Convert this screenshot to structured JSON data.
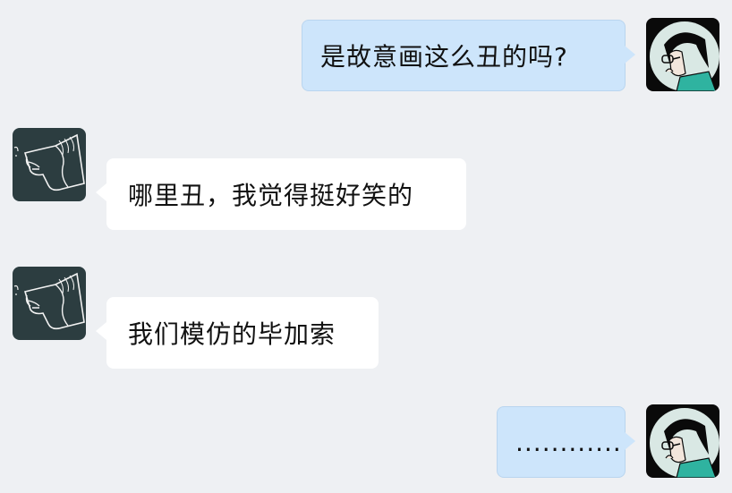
{
  "messages": [
    {
      "sender": "me",
      "text": "是故意画这么丑的吗?",
      "avatar": "woman-with-glasses-avatar"
    },
    {
      "sender": "other",
      "text": "哪里丑，我觉得挺好笑的",
      "avatar": "sketch-face-avatar"
    },
    {
      "sender": "other",
      "text": "我们模仿的毕加索",
      "avatar": "sketch-face-avatar"
    },
    {
      "sender": "me",
      "text": "............",
      "avatar": "woman-with-glasses-avatar"
    }
  ],
  "colors": {
    "background": "#eef0f3",
    "outgoing_bubble": "#cde5fb",
    "incoming_bubble": "#ffffff",
    "text": "#111111"
  }
}
